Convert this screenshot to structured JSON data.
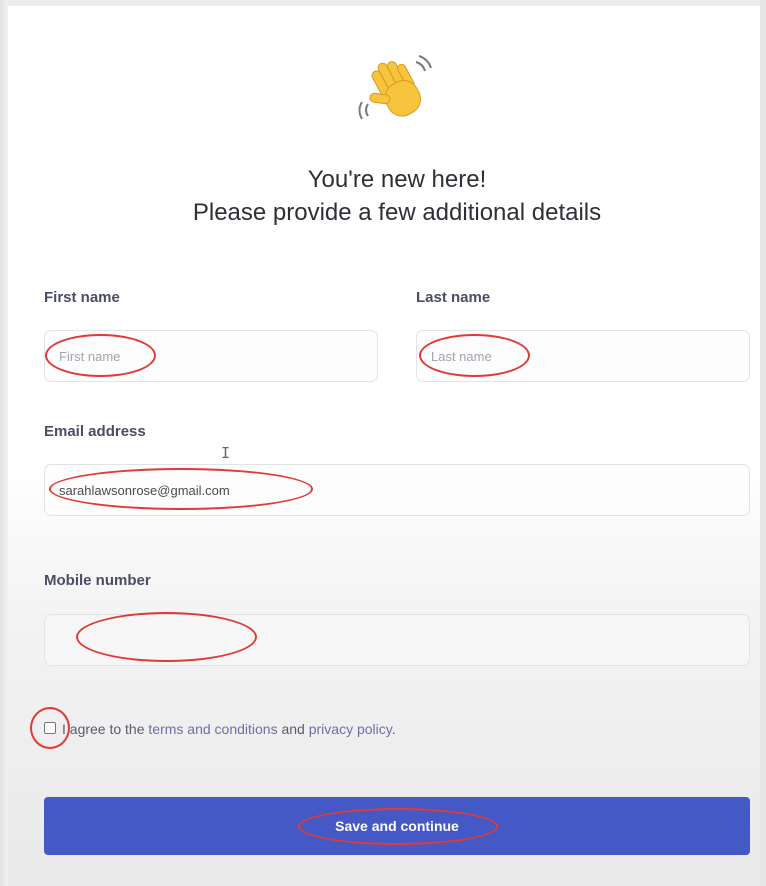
{
  "header": {
    "icon": "waving-hand-icon",
    "title_line1": "You're new here!",
    "title_line2": "Please provide a few additional details"
  },
  "form": {
    "first_name": {
      "label": "First name",
      "placeholder": "First name",
      "value": ""
    },
    "last_name": {
      "label": "Last name",
      "placeholder": "Last name",
      "value": ""
    },
    "email": {
      "label": "Email address",
      "value": "sarahlawsonrose@gmail.com"
    },
    "mobile": {
      "label": "Mobile number",
      "value": ""
    },
    "agreement": {
      "prefix": "I agree to the ",
      "terms_link": "terms and conditions",
      "middle": " and ",
      "privacy_link": "privacy policy",
      "suffix": ".",
      "checked": false
    },
    "submit_label": "Save and continue"
  },
  "colors": {
    "accent": "#4559c6",
    "annotation_ring": "#e03a36",
    "link": "#6b6fa8",
    "label": "#4a4d66"
  }
}
